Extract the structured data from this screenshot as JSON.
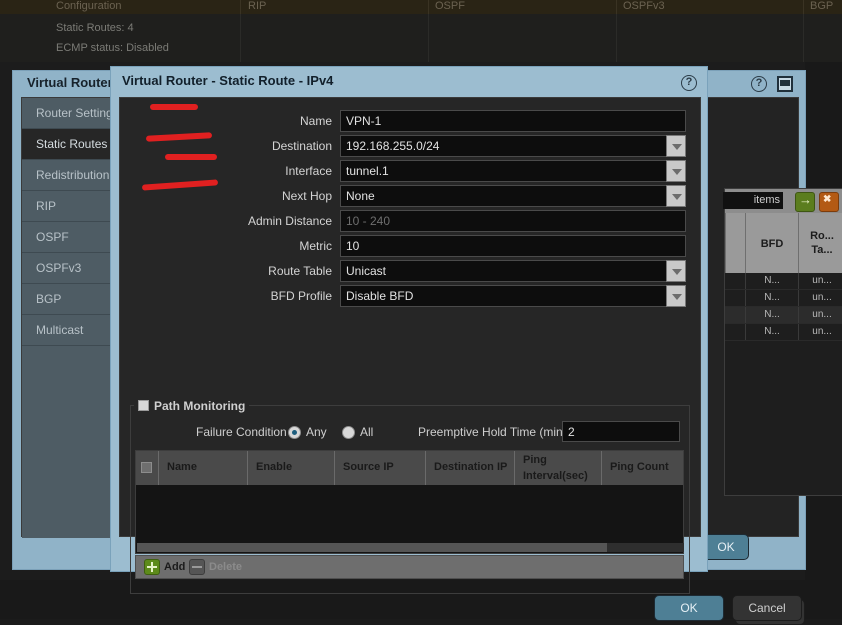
{
  "background": {
    "topbar_columns": [
      "Configuration",
      "RIP",
      "OSPF",
      "OSPFv3",
      "BGP"
    ],
    "summary_lines": [
      "Static Routes: 4",
      "ECMP status: Disabled"
    ]
  },
  "vr_dialog": {
    "title": "Virtual Router - d",
    "help_icon": "help-circle-icon",
    "window_icon": "window-restore-icon",
    "tabs": [
      {
        "label": "Router Settings",
        "selected": false
      },
      {
        "label": "Static Routes",
        "selected": true
      },
      {
        "label": "Redistribution Pr",
        "selected": false
      },
      {
        "label": "RIP",
        "selected": false
      },
      {
        "label": "OSPF",
        "selected": false
      },
      {
        "label": "OSPFv3",
        "selected": false
      },
      {
        "label": "BGP",
        "selected": false
      },
      {
        "label": "Multicast",
        "selected": false
      }
    ],
    "grid": {
      "search_value": "items",
      "go_icon": "arrow-right-icon",
      "clear_icon": "close-x-icon",
      "columns": [
        "BFD",
        "Ro... Ta..."
      ],
      "column_bfd": "BFD",
      "column_route_table_1": "Ro...",
      "column_route_table_2": "Ta...",
      "rows": [
        {
          "bfd": "N...",
          "route_table": "un..."
        },
        {
          "bfd": "N...",
          "route_table": "un..."
        },
        {
          "bfd": "N...",
          "route_table": "un..."
        },
        {
          "bfd": "N...",
          "route_table": "un..."
        }
      ]
    },
    "ok_label": "OK",
    "cancel_label": "Cancel"
  },
  "modal": {
    "title": "Virtual Router - Static Route - IPv4",
    "help_icon": "help-circle-icon",
    "fields": {
      "name": {
        "label": "Name",
        "value": "VPN-1",
        "type": "text"
      },
      "destination": {
        "label": "Destination",
        "value": "192.168.255.0/24",
        "type": "select"
      },
      "interface": {
        "label": "Interface",
        "value": "tunnel.1",
        "type": "select"
      },
      "next_hop": {
        "label": "Next Hop",
        "value": "None",
        "type": "select"
      },
      "admin_distance": {
        "label": "Admin Distance",
        "value": "",
        "placeholder": "10 - 240",
        "type": "text"
      },
      "metric": {
        "label": "Metric",
        "value": "10",
        "type": "text"
      },
      "route_table": {
        "label": "Route Table",
        "value": "Unicast",
        "type": "select"
      },
      "bfd_profile": {
        "label": "BFD Profile",
        "value": "Disable BFD",
        "type": "select"
      }
    },
    "path_monitoring": {
      "legend": "Path Monitoring",
      "checked": false,
      "failure_condition_label": "Failure Condition",
      "option_any": "Any",
      "option_all": "All",
      "selected_option": "Any",
      "preemptive_label": "Preemptive Hold Time (min)",
      "preemptive_value": "2",
      "columns": [
        "Name",
        "Enable",
        "Source IP",
        "Destination IP",
        "Ping Interval(sec)",
        "Ping Count"
      ],
      "col_ping_interval_1": "Ping",
      "col_ping_interval_2": "Interval(sec)",
      "rows": [],
      "add_label": "Add",
      "delete_label": "Delete",
      "add_icon": "plus-icon",
      "delete_icon": "minus-icon"
    },
    "ok_label": "OK",
    "cancel_label": "Cancel"
  },
  "colors": {
    "dialog_chrome": "#9cbdd0",
    "accent_primary": "#4e7f95",
    "annotation_red": "#e02020",
    "field_bg": "#0d0d0d"
  }
}
